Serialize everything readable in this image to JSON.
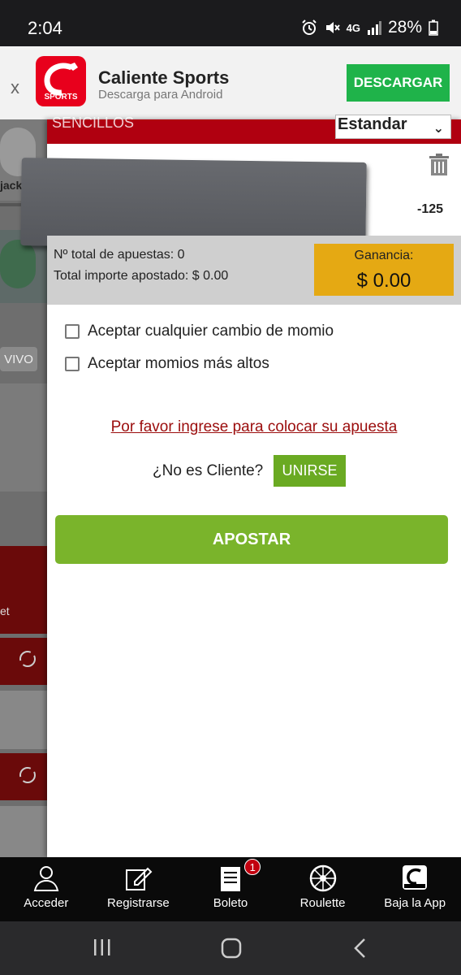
{
  "status_bar": {
    "time": "2:04",
    "network": "4G",
    "battery": "28%"
  },
  "promo": {
    "close": "x",
    "app_name": "Caliente Sports",
    "subtitle": "Descarga para Android",
    "logo_text": "SPORTS",
    "download_label": "DESCARGAR"
  },
  "background_page": {
    "item_label": "jack",
    "live_label": "VIVO",
    "bet_fragment": "et"
  },
  "bet_slip": {
    "section_label": "SENCILLOS",
    "bet_type": "Estandar",
    "odds": "-125",
    "total_bets_label": "Nº total de apuestas: 0",
    "total_amount_label": "Total importe apostado: $ 0.00",
    "gain_label": "Ganancia:",
    "gain_value": "$ 0.00",
    "accept_any_change": "Aceptar cualquier cambio de momio",
    "accept_higher": "Aceptar momios más altos",
    "login_prompt": "Por favor ingrese para colocar su apuesta",
    "not_client": "¿No es Cliente?",
    "join_label": "UNIRSE",
    "bet_label": "APOSTAR"
  },
  "tabbar": {
    "items": [
      {
        "label": "Acceder",
        "icon": "user-icon"
      },
      {
        "label": "Registrarse",
        "icon": "edit-icon"
      },
      {
        "label": "Boleto",
        "icon": "ticket-icon",
        "badge": "1"
      },
      {
        "label": "Roulette",
        "icon": "roulette-icon"
      },
      {
        "label": "Baja la App",
        "icon": "app-logo-icon"
      }
    ]
  },
  "colors": {
    "brand_red": "#b00010",
    "accent_green": "#7ab42b",
    "gain_yellow": "#e5a913",
    "download_green": "#1fb34a"
  }
}
